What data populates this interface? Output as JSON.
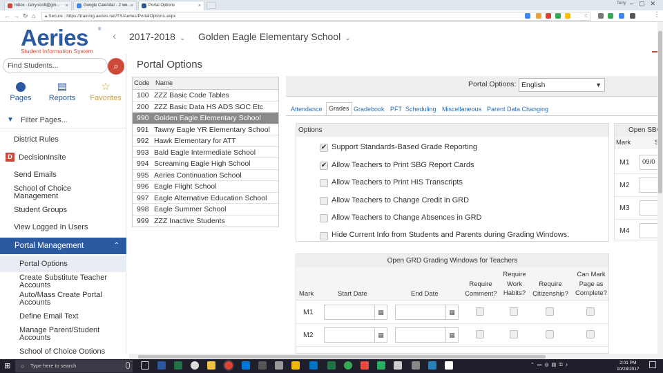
{
  "browser": {
    "tabs": [
      {
        "label": "Inbox - terry.scott@gm...",
        "icon_color": "#d44638"
      },
      {
        "label": "Google Calendar - 2 we...",
        "icon_color": "#4285f4"
      },
      {
        "label": "Portal Options",
        "icon_color": "#2c5aa0"
      }
    ],
    "secure_label": "Secure",
    "url": "https://training.aeries.net/TS/Aeries/PortalOptions.aspx",
    "profile": "Terry"
  },
  "header": {
    "logo": "Aeries",
    "logo_sub": "Student Information System",
    "year": "2017-2018",
    "school": "Golden Eagle Elementary School"
  },
  "sidebar": {
    "search_placeholder": "Find Students...",
    "quick": [
      {
        "label": "Pages",
        "icon": "circle-icon"
      },
      {
        "label": "Reports",
        "icon": "document-icon"
      },
      {
        "label": "Favorites",
        "icon": "star-icon"
      }
    ],
    "filter_label": "Filter Pages...",
    "items": [
      "District Rules",
      "DecisionInsite",
      "Send Emails",
      "School of Choice Management",
      "Student Groups",
      "View Logged In Users"
    ],
    "section": "Portal Management",
    "active": "Portal Options",
    "subitems": [
      "Create Substitute Teacher Accounts",
      "Auto/Mass Create Portal Accounts",
      "Define Email Text",
      "Manage Parent/Student Accounts",
      "School of Choice Options"
    ]
  },
  "main": {
    "title": "Portal Options",
    "school_table": {
      "headers": [
        "Code",
        "Name"
      ],
      "rows": [
        {
          "code": "100",
          "name": "ZZZ Basic Code Tables"
        },
        {
          "code": "200",
          "name": "ZZZ Basic Data HS ADS SOC Etc"
        },
        {
          "code": "990",
          "name": "Golden Eagle Elementary School"
        },
        {
          "code": "991",
          "name": "Tawny Eagle YR Elementary School"
        },
        {
          "code": "992",
          "name": "Hawk Elementary for ATT"
        },
        {
          "code": "993",
          "name": "Bald Eagle Intermediate School"
        },
        {
          "code": "994",
          "name": "Screaming Eagle High School"
        },
        {
          "code": "995",
          "name": "Aeries Continuation School"
        },
        {
          "code": "996",
          "name": "Eagle Flight School"
        },
        {
          "code": "997",
          "name": "Eagle Alternative Education School"
        },
        {
          "code": "998",
          "name": "Eagle Summer School"
        },
        {
          "code": "999",
          "name": "ZZZ Inactive Students"
        }
      ],
      "selected_code": "990"
    },
    "portal_options_label": "Portal Options:",
    "language": "English",
    "tabs": [
      "Attendance",
      "Grades",
      "Gradebook",
      "PFT",
      "Scheduling",
      "Miscellaneous",
      "Parent Data Changing"
    ],
    "active_tab": "Grades",
    "options_header": "Options",
    "options": [
      {
        "label": "Support Standards-Based Grade Reporting",
        "checked": true
      },
      {
        "label": "Allow Teachers to Print SBG Report Cards",
        "checked": true
      },
      {
        "label": "Allow Teachers to Print HIS Transcripts",
        "checked": false
      },
      {
        "label": "Allow Teachers to Change Credit in GRD",
        "checked": false
      },
      {
        "label": "Allow Teachers to Change Absences in GRD",
        "checked": false
      },
      {
        "label": "Hide Current Info from Students and Parents during Grading Windows.",
        "checked": false
      }
    ],
    "windows": {
      "title": "Open GRD Grading Windows for Teachers",
      "col_mark": "Mark",
      "col_start": "Start Date",
      "col_end": "End Date",
      "col_comment": "Require Comment?",
      "col_work": "Require Work Habits?",
      "col_citizenship": "Require Citizenship?",
      "col_complete": "Can Mark Page as Complete?",
      "rows": [
        "M1",
        "M2"
      ]
    },
    "sbg": {
      "title": "Open SBG",
      "col_mark": "Mark",
      "col_s": "S",
      "rows": [
        {
          "mark": "M1",
          "value": "09/0"
        },
        {
          "mark": "M2",
          "value": ""
        },
        {
          "mark": "M3",
          "value": ""
        },
        {
          "mark": "M4",
          "value": ""
        }
      ]
    }
  },
  "taskbar": {
    "search_placeholder": "Type here to search",
    "time": "2:01 PM",
    "date": "10/28/2017"
  }
}
